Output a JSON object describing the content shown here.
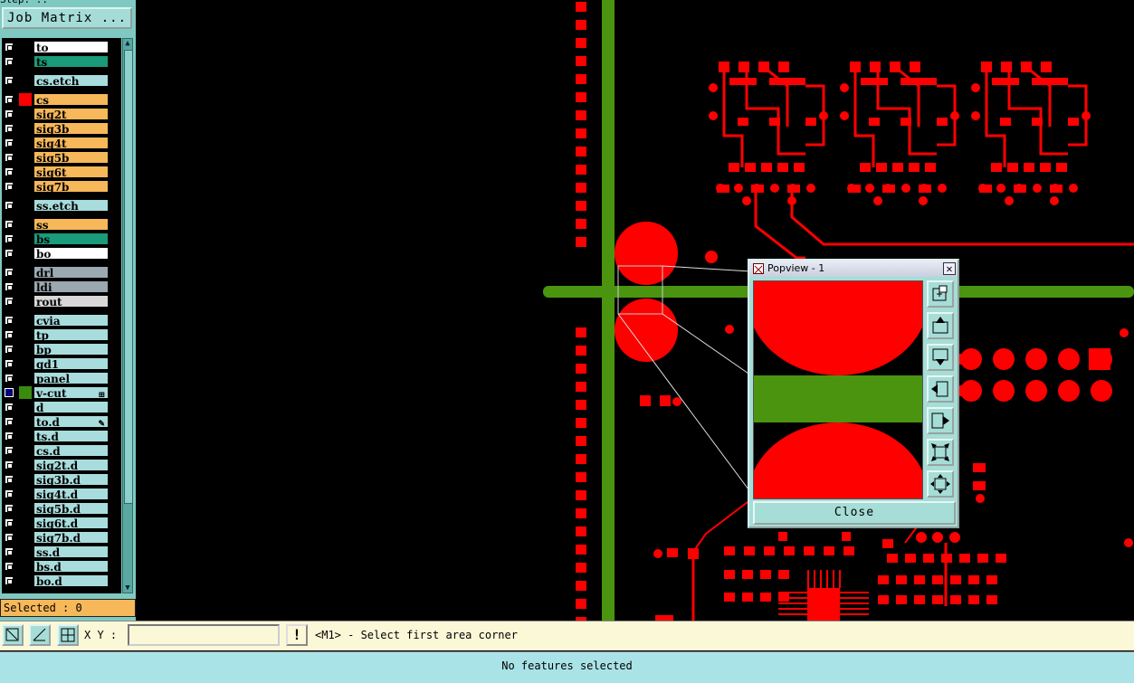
{
  "left_panel": {
    "step_title": "Step: ..",
    "job_matrix_label": "Job Matrix ...",
    "layers": [
      {
        "name": "to",
        "color": "#ffffff"
      },
      {
        "name": "ts",
        "color": "#1a9b7a"
      },
      {
        "name": "cs.etch",
        "color": "#a9dcdc"
      },
      {
        "name": "cs",
        "color": "#f7b85a",
        "swatch": "#ff0000"
      },
      {
        "name": "sig2t",
        "color": "#f7b85a"
      },
      {
        "name": "sig3b",
        "color": "#f7b85a"
      },
      {
        "name": "sig4t",
        "color": "#f7b85a"
      },
      {
        "name": "sig5b",
        "color": "#f7b85a"
      },
      {
        "name": "sig6t",
        "color": "#f7b85a"
      },
      {
        "name": "sig7b",
        "color": "#f7b85a"
      },
      {
        "name": "ss.etch",
        "color": "#a9dcdc"
      },
      {
        "name": "ss",
        "color": "#f7b85a"
      },
      {
        "name": "bs",
        "color": "#1a9b7a"
      },
      {
        "name": "bo",
        "color": "#ffffff"
      },
      {
        "name": "drl",
        "color": "#9aa8b0"
      },
      {
        "name": "ldi",
        "color": "#9aa8b0"
      },
      {
        "name": "rout",
        "color": "#d8d8d8"
      },
      {
        "name": "cvia",
        "color": "#a9dcdc"
      },
      {
        "name": "tp",
        "color": "#a9dcdc"
      },
      {
        "name": "bp",
        "color": "#a9dcdc"
      },
      {
        "name": "gd1",
        "color": "#a9dcdc"
      },
      {
        "name": "panel",
        "color": "#a9dcdc"
      },
      {
        "name": "v-cut",
        "color": "#a9dcdc",
        "swatch": "#3a8a10",
        "active": true,
        "marker": "⊞"
      },
      {
        "name": "d",
        "color": "#a9dcdc"
      },
      {
        "name": "to.d",
        "color": "#a9dcdc",
        "marker": "✎"
      },
      {
        "name": "ts.d",
        "color": "#a9dcdc"
      },
      {
        "name": "cs.d",
        "color": "#a9dcdc"
      },
      {
        "name": "sig2t.d",
        "color": "#a9dcdc"
      },
      {
        "name": "sig3b.d",
        "color": "#a9dcdc"
      },
      {
        "name": "sig4t.d",
        "color": "#a9dcdc"
      },
      {
        "name": "sig5b.d",
        "color": "#a9dcdc"
      },
      {
        "name": "sig6t.d",
        "color": "#a9dcdc"
      },
      {
        "name": "sig7b.d",
        "color": "#a9dcdc"
      },
      {
        "name": "ss.d",
        "color": "#a9dcdc"
      },
      {
        "name": "bs.d",
        "color": "#a9dcdc"
      },
      {
        "name": "bo.d",
        "color": "#a9dcdc"
      }
    ],
    "selected_label": "Selected : 0"
  },
  "command_bar": {
    "xy_label": "X Y :",
    "xy_value": "",
    "info_label": "!",
    "prompt": "<M1> - Select first area corner"
  },
  "status_bar": {
    "text": "No features selected"
  },
  "popview": {
    "title": "Popview - 1",
    "close_label": "Close",
    "close_x": "✕"
  },
  "colors": {
    "copper": "#ff0000",
    "vcut": "#4a9410",
    "panel_bg": "#7fc9c2"
  }
}
